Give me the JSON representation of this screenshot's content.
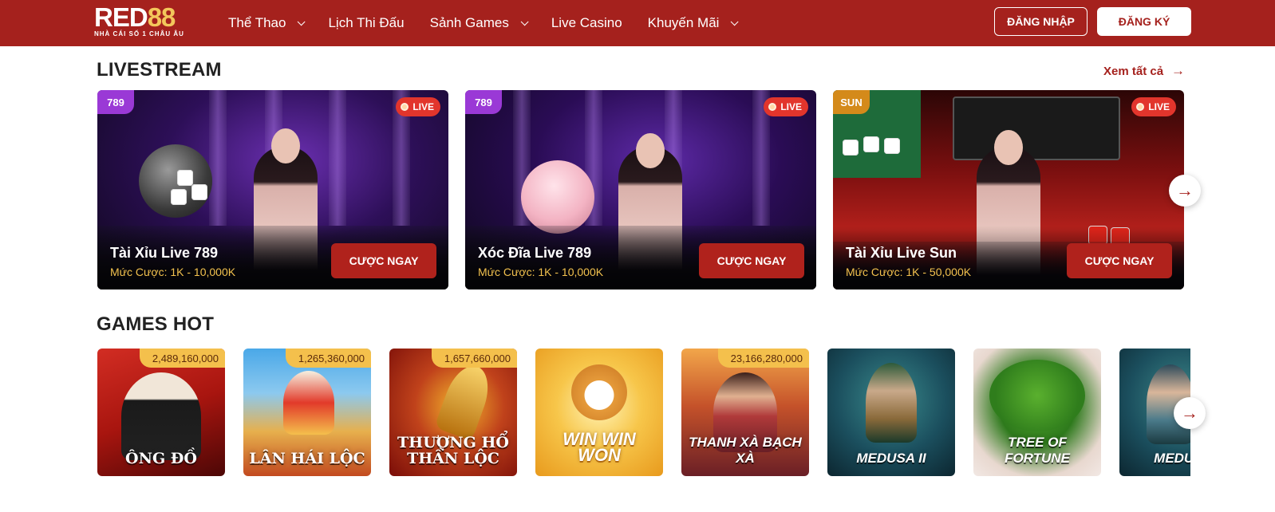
{
  "header": {
    "logo_text_a": "RED",
    "logo_text_b": "88",
    "logo_tagline": "NHÀ CÁI SỐ 1 CHÂU ÂU",
    "nav": [
      {
        "label": "Thể Thao",
        "has_dropdown": true
      },
      {
        "label": "Lịch Thi Đấu",
        "has_dropdown": false
      },
      {
        "label": "Sảnh Games",
        "has_dropdown": true
      },
      {
        "label": "Live Casino",
        "has_dropdown": false
      },
      {
        "label": "Khuyến Mãi",
        "has_dropdown": true
      }
    ],
    "login_label": "ĐĂNG NHẬP",
    "register_label": "ĐĂNG KÝ"
  },
  "livestream": {
    "title": "LIVESTREAM",
    "see_all_label": "Xem tất cả",
    "live_label": "LIVE",
    "cards": [
      {
        "studio": "789",
        "name": "Tài Xỉu Live 789",
        "bet_range": "Mức Cược: 1K - 10,000K",
        "button": "CƯỢC NGAY"
      },
      {
        "studio": "789",
        "name": "Xóc Đĩa Live 789",
        "bet_range": "Mức Cược: 1K - 10,000K",
        "button": "CƯỢC NGAY"
      },
      {
        "studio": "SUN",
        "name": "Tài Xỉu Live Sun",
        "bet_range": "Mức Cược: 1K - 50,000K",
        "button": "CƯỢC NGAY"
      }
    ]
  },
  "games_hot": {
    "title": "GAMES HOT",
    "games": [
      {
        "title": "ÔNG ĐỒ",
        "jackpot": "2,489,160,000"
      },
      {
        "title": "LÂN HÁI LỘC",
        "jackpot": "1,265,360,000"
      },
      {
        "title": "THƯỢNG HỔ THẦN LỘC",
        "jackpot": "1,657,660,000"
      },
      {
        "title": "WIN WIN WON",
        "jackpot": ""
      },
      {
        "title": "THANH XÀ BẠCH XÀ",
        "jackpot": "23,166,280,000"
      },
      {
        "title": "MEDUSA II",
        "jackpot": ""
      },
      {
        "title": "TREE OF FORTUNE",
        "jackpot": ""
      },
      {
        "title": "MEDUSA",
        "jackpot": ""
      }
    ]
  },
  "icons": {
    "next_arrow": "arrow-right-icon",
    "dropdown": "chevron-down-icon",
    "see_all_arrow": "arrow-right-icon"
  },
  "colors": {
    "brand_red": "#a5211d",
    "live_red": "#e2352c",
    "bet_gold": "#f2c14e",
    "jackpot_gold": "#f4c04c"
  }
}
